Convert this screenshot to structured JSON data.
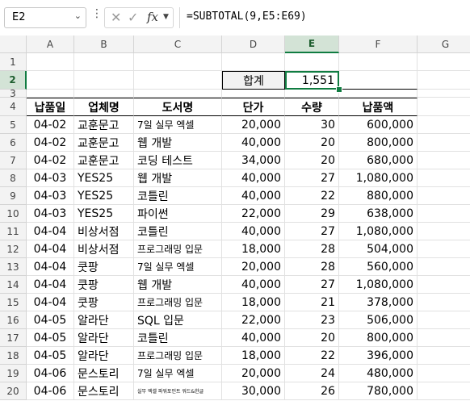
{
  "formula_bar": {
    "name_box": "E2",
    "formula": "=SUBTOTAL(9,E5:E69)",
    "fx_label": "fx"
  },
  "columns": [
    "A",
    "B",
    "C",
    "D",
    "E",
    "F",
    "G"
  ],
  "selected_column": "E",
  "selected_row": "2",
  "summary": {
    "label": "합계",
    "value": "1,551"
  },
  "headers": [
    "납품일",
    "업체명",
    "도서명",
    "단가",
    "수량",
    "납품액"
  ],
  "rows": [
    {
      "n": "5",
      "date": "04-02",
      "vendor": "교훈문고",
      "title": "7일 실무 엑셀",
      "price": "20,000",
      "qty": "30",
      "amount": "600,000"
    },
    {
      "n": "6",
      "date": "04-02",
      "vendor": "교훈문고",
      "title": "웹 개발",
      "price": "40,000",
      "qty": "20",
      "amount": "800,000"
    },
    {
      "n": "7",
      "date": "04-02",
      "vendor": "교훈문고",
      "title": "코딩 테스트",
      "price": "34,000",
      "qty": "20",
      "amount": "680,000"
    },
    {
      "n": "8",
      "date": "04-03",
      "vendor": "YES25",
      "title": "웹 개발",
      "price": "40,000",
      "qty": "27",
      "amount": "1,080,000"
    },
    {
      "n": "9",
      "date": "04-03",
      "vendor": "YES25",
      "title": "코틀린",
      "price": "40,000",
      "qty": "22",
      "amount": "880,000"
    },
    {
      "n": "10",
      "date": "04-03",
      "vendor": "YES25",
      "title": "파이썬",
      "price": "22,000",
      "qty": "29",
      "amount": "638,000"
    },
    {
      "n": "11",
      "date": "04-04",
      "vendor": "비상서점",
      "title": "코틀린",
      "price": "40,000",
      "qty": "27",
      "amount": "1,080,000"
    },
    {
      "n": "12",
      "date": "04-04",
      "vendor": "비상서점",
      "title": "프로그래밍 입문",
      "price": "18,000",
      "qty": "28",
      "amount": "504,000"
    },
    {
      "n": "13",
      "date": "04-04",
      "vendor": "쿳팡",
      "title": "7일 실무 엑셀",
      "price": "20,000",
      "qty": "28",
      "amount": "560,000"
    },
    {
      "n": "14",
      "date": "04-04",
      "vendor": "쿳팡",
      "title": "웹 개발",
      "price": "40,000",
      "qty": "27",
      "amount": "1,080,000"
    },
    {
      "n": "15",
      "date": "04-04",
      "vendor": "쿳팡",
      "title": "프로그래밍 입문",
      "price": "18,000",
      "qty": "21",
      "amount": "378,000"
    },
    {
      "n": "16",
      "date": "04-05",
      "vendor": "알라단",
      "title": "SQL 입문",
      "price": "22,000",
      "qty": "23",
      "amount": "506,000"
    },
    {
      "n": "17",
      "date": "04-05",
      "vendor": "알라단",
      "title": "코틀린",
      "price": "40,000",
      "qty": "20",
      "amount": "800,000"
    },
    {
      "n": "18",
      "date": "04-05",
      "vendor": "알라단",
      "title": "프로그래밍 입문",
      "price": "18,000",
      "qty": "22",
      "amount": "396,000"
    },
    {
      "n": "19",
      "date": "04-06",
      "vendor": "문스토리",
      "title": "7일 실무 엑셀",
      "price": "20,000",
      "qty": "24",
      "amount": "480,000"
    },
    {
      "n": "20",
      "date": "04-06",
      "vendor": "문스토리",
      "title": "실무 엑셀 파워포인트 워드&한글",
      "price": "30,000",
      "qty": "26",
      "amount": "780,000"
    }
  ]
}
